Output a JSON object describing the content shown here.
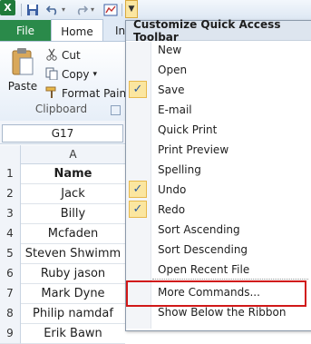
{
  "toolbar": {
    "app_icon_letter": "X"
  },
  "tabs": {
    "file": "File",
    "home": "Home",
    "insert_partial": "In"
  },
  "clipboard": {
    "paste": "Paste",
    "cut": "Cut",
    "copy": "Copy",
    "copy_arrow": "▾",
    "format_painter": "Format Painte",
    "group_label": "Clipboard"
  },
  "name_box": "G17",
  "sheet": {
    "column": "A",
    "rows": [
      {
        "num": "1",
        "value": "Name",
        "bold": true
      },
      {
        "num": "2",
        "value": "Jack"
      },
      {
        "num": "3",
        "value": "Billy"
      },
      {
        "num": "4",
        "value": "Mcfaden"
      },
      {
        "num": "5",
        "value": "Steven Shwimm"
      },
      {
        "num": "6",
        "value": "Ruby jason"
      },
      {
        "num": "7",
        "value": "Mark Dyne"
      },
      {
        "num": "8",
        "value": "Philip namdaf"
      },
      {
        "num": "9",
        "value": "Erik Bawn"
      }
    ]
  },
  "menu": {
    "title": "Customize Quick Access Toolbar",
    "items": [
      {
        "label": "New",
        "checked": false
      },
      {
        "label": "Open",
        "checked": false
      },
      {
        "label": "Save",
        "checked": true
      },
      {
        "label": "E-mail",
        "checked": false
      },
      {
        "label": "Quick Print",
        "checked": false
      },
      {
        "label": "Print Preview",
        "checked": false
      },
      {
        "label": "Spelling",
        "checked": false
      },
      {
        "label": "Undo",
        "checked": true
      },
      {
        "label": "Redo",
        "checked": true
      },
      {
        "label": "Sort Ascending",
        "checked": false
      },
      {
        "label": "Sort Descending",
        "checked": false
      },
      {
        "label": "Open Recent File",
        "checked": false
      },
      {
        "label": "More Commands...",
        "checked": false
      },
      {
        "label": "Show Below the Ribbon",
        "checked": false
      }
    ],
    "check_glyph": "✓"
  },
  "colors": {
    "file_tab": "#2a8a4a",
    "highlight_box": "#d11818",
    "check_bg": "#fbe6a0"
  }
}
